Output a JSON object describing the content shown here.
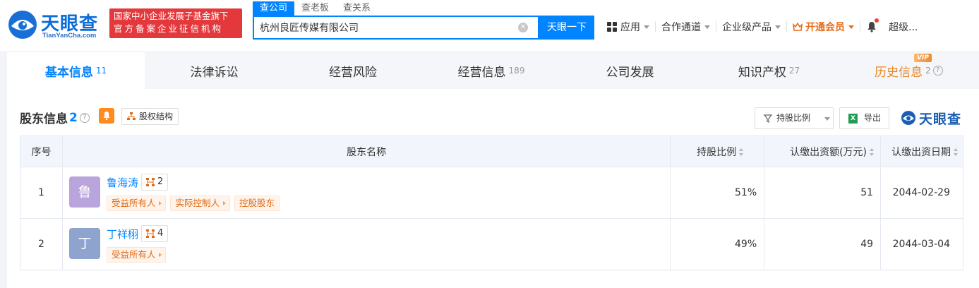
{
  "header": {
    "logo_cn": "天眼查",
    "logo_en": "TianYanCha.com",
    "slogan_line1": "国家中小企业发展子基金旗下",
    "slogan_line2": "官方备案企业征信机构",
    "search_tabs": [
      "查公司",
      "查老板",
      "查关系"
    ],
    "search_value": "杭州良匠传媒有限公司",
    "search_button": "天眼一下",
    "nav": {
      "app": "应用",
      "channel": "合作通道",
      "enterprise": "企业级产品",
      "vip": "开通会员",
      "user": "超级..."
    }
  },
  "tabs": [
    {
      "label": "基本信息",
      "count": "11"
    },
    {
      "label": "法律诉讼",
      "count": ""
    },
    {
      "label": "经营风险",
      "count": ""
    },
    {
      "label": "经营信息",
      "count": "189"
    },
    {
      "label": "公司发展",
      "count": ""
    },
    {
      "label": "知识产权",
      "count": "27"
    },
    {
      "label": "历史信息",
      "count": "2"
    }
  ],
  "vip_badge": "VIP",
  "section": {
    "title": "股东信息",
    "count": "2",
    "equity_button": "股权结构",
    "ratio_button": "持股比例",
    "export_button": "导出",
    "brand": "天眼查"
  },
  "table": {
    "headers": {
      "index": "序号",
      "name": "股东名称",
      "ratio": "持股比例",
      "amount": "认缴出资额(万元)",
      "date": "认缴出资日期"
    },
    "rows": [
      {
        "index": "1",
        "avatar_char": "鲁",
        "avatar_color": "#b9a4db",
        "name": "鲁海涛",
        "related": "2",
        "tags": [
          "受益所有人",
          "实际控制人",
          "控股股东"
        ],
        "ratio": "51%",
        "amount": "51",
        "date": "2044-02-29"
      },
      {
        "index": "2",
        "avatar_char": "丁",
        "avatar_color": "#8fa3cf",
        "name": "丁祥栩",
        "related": "4",
        "tags": [
          "受益所有人"
        ],
        "ratio": "49%",
        "amount": "49",
        "date": "2044-03-04"
      }
    ]
  },
  "colors": {
    "brand_blue": "#0084ff",
    "slogan_red": "#e4393c",
    "tag_orange": "#e06912",
    "vip_orange": "#e66e1d"
  }
}
